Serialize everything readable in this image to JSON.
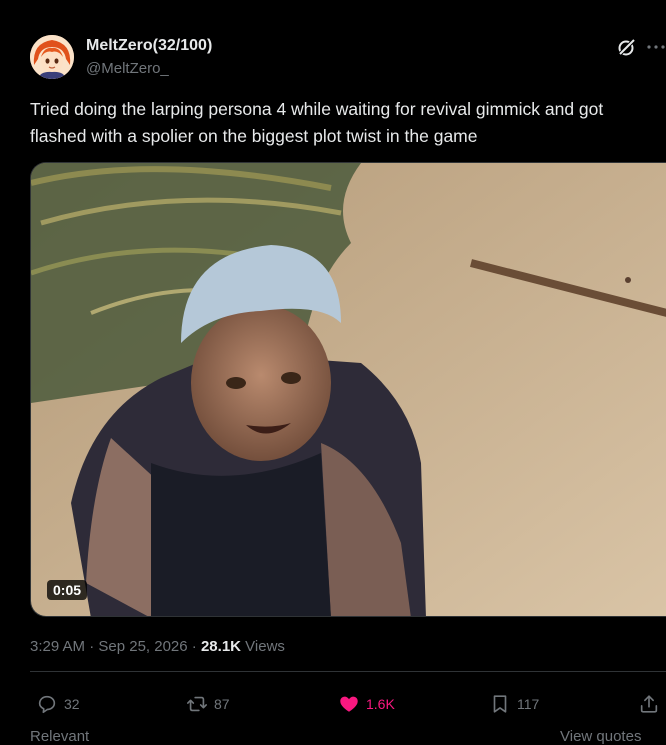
{
  "author": {
    "name": "MeltZero(32/100)",
    "handle": "@MeltZero_"
  },
  "post": {
    "text": "Tried doing the larping persona 4 while waiting for revival gimmick and got flashed with a spolier on the biggest plot twist in the game",
    "media": {
      "duration": "0:05"
    },
    "timestamp": "3:29 AM · Sep 25, 2026",
    "separator": " · ",
    "views_count": "28.1K",
    "views_label": " Views"
  },
  "actions": {
    "replies": "32",
    "reposts": "87",
    "likes": "1.6K",
    "bookmarks": "117"
  },
  "footer": {
    "left_label": "Relevant",
    "right_label": "View quotes"
  },
  "colors": {
    "background": "#000000",
    "text_primary": "#e7e9ea",
    "text_secondary": "#71767b",
    "like_active": "#f91880",
    "border": "#2f3336"
  },
  "icons": {
    "grok": "grok-icon",
    "more": "more-icon",
    "reply": "reply-icon",
    "repost": "repost-icon",
    "like": "heart-icon",
    "bookmark": "bookmark-icon",
    "share": "share-icon"
  }
}
